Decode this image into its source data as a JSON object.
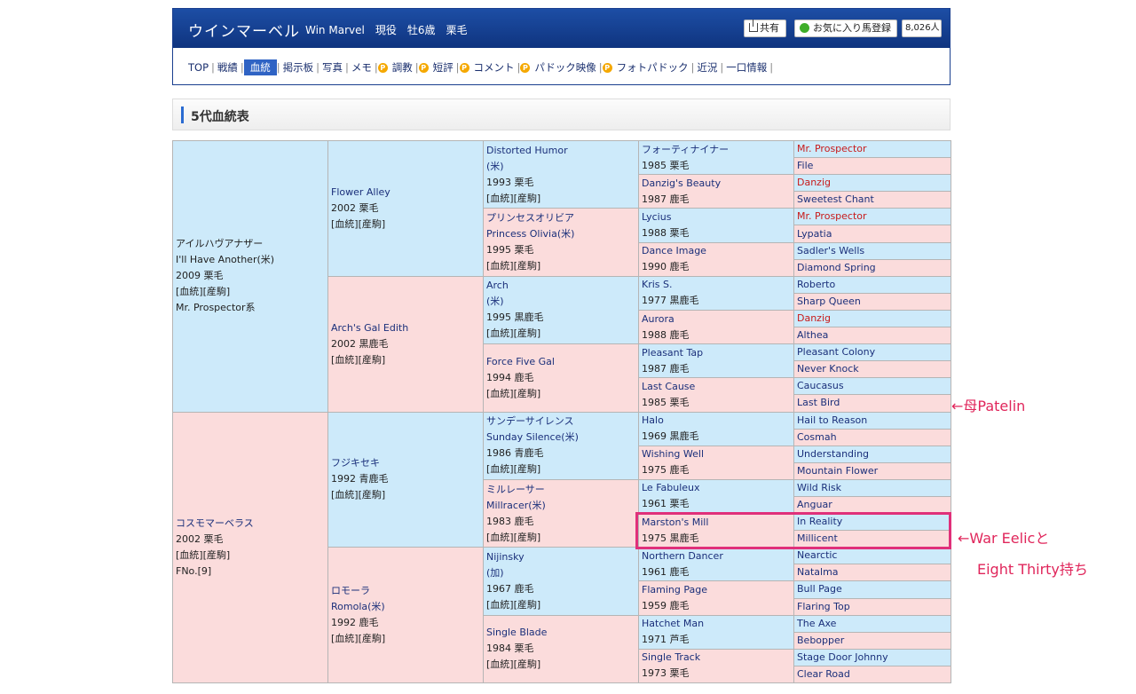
{
  "header": {
    "horse_name": "ウインマーベル",
    "horse_sub": "Win Marvel　現役　牡6歳　栗毛",
    "share_label": "共有",
    "fav_label": "お気に入り馬登録",
    "fav_count": "8,026人"
  },
  "nav": {
    "items": [
      {
        "label": "TOP",
        "p": false,
        "active": false
      },
      {
        "label": "戦績",
        "p": false,
        "active": false
      },
      {
        "label": "血統",
        "p": false,
        "active": true
      },
      {
        "label": "掲示板",
        "p": false,
        "active": false
      },
      {
        "label": "写真",
        "p": false,
        "active": false
      },
      {
        "label": "メモ",
        "p": false,
        "active": false
      },
      {
        "label": "調教",
        "p": true,
        "active": false
      },
      {
        "label": "短評",
        "p": true,
        "active": false
      },
      {
        "label": "コメント",
        "p": true,
        "active": false
      },
      {
        "label": "パドック映像",
        "p": true,
        "active": false
      },
      {
        "label": "フォトパドック",
        "p": true,
        "active": false
      },
      {
        "label": "近況",
        "p": false,
        "active": false
      },
      {
        "label": "一口情報",
        "p": false,
        "active": false
      }
    ]
  },
  "section_title": "5代血統表",
  "pedigree": {
    "g1": [
      {
        "sex": "m",
        "lines": [
          "アイルハヴアナザー",
          "I'll Have Another(米)",
          "2009 栗毛",
          "[血統][産駒]",
          "Mr. Prospector系"
        ]
      },
      {
        "sex": "f",
        "lines": [
          "コスモマーベラス",
          "2002 栗毛",
          "[血統][産駒]",
          "FNo.[9]"
        ]
      }
    ],
    "g2": [
      {
        "sex": "m",
        "lines": [
          "Flower Alley",
          "2002 栗毛",
          "[血統][産駒]"
        ]
      },
      {
        "sex": "f",
        "lines": [
          "Arch's Gal Edith",
          "2002 黒鹿毛",
          "[血統][産駒]"
        ]
      },
      {
        "sex": "m",
        "lines": [
          "フジキセキ",
          "1992 青鹿毛",
          "[血統][産駒]"
        ]
      },
      {
        "sex": "f",
        "lines": [
          "ロモーラ",
          "Romola(米)",
          "1992 鹿毛",
          "[血統][産駒]"
        ]
      }
    ],
    "g3": [
      {
        "sex": "m",
        "lines": [
          "Distorted Humor",
          "(米)",
          "1993 栗毛",
          "[血統][産駒]"
        ]
      },
      {
        "sex": "f",
        "lines": [
          "プリンセスオリビア",
          "Princess Olivia(米)",
          "1995 栗毛",
          "[血統][産駒]"
        ]
      },
      {
        "sex": "m",
        "lines": [
          "Arch",
          "(米)",
          "1995 黒鹿毛",
          "[血統][産駒]"
        ]
      },
      {
        "sex": "f",
        "lines": [
          "Force Five Gal",
          "1994 鹿毛",
          "[血統][産駒]"
        ]
      },
      {
        "sex": "m",
        "lines": [
          "サンデーサイレンス",
          "Sunday Silence(米)",
          "1986 青鹿毛",
          "[血統][産駒]"
        ]
      },
      {
        "sex": "f",
        "lines": [
          "ミルレーサー",
          "Millracer(米)",
          "1983 鹿毛",
          "[血統][産駒]"
        ]
      },
      {
        "sex": "m",
        "lines": [
          "Nijinsky",
          "(加)",
          "1967 鹿毛",
          "[血統][産駒]"
        ]
      },
      {
        "sex": "f",
        "lines": [
          "Single Blade",
          "1984 栗毛",
          "[血統][産駒]"
        ]
      }
    ],
    "g4": [
      {
        "sex": "m",
        "lines": [
          "フォーティナイナー",
          "1985 栗毛"
        ]
      },
      {
        "sex": "f",
        "lines": [
          "Danzig's Beauty",
          "1987 鹿毛"
        ]
      },
      {
        "sex": "m",
        "lines": [
          "Lycius",
          "1988 栗毛"
        ]
      },
      {
        "sex": "f",
        "lines": [
          "Dance Image",
          "1990 鹿毛"
        ]
      },
      {
        "sex": "m",
        "lines": [
          "Kris S.",
          "1977 黒鹿毛"
        ]
      },
      {
        "sex": "f",
        "lines": [
          "Aurora",
          "1988 鹿毛"
        ]
      },
      {
        "sex": "m",
        "lines": [
          "Pleasant Tap",
          "1987 鹿毛"
        ]
      },
      {
        "sex": "f",
        "lines": [
          "Last Cause",
          "1985 栗毛"
        ]
      },
      {
        "sex": "m",
        "lines": [
          "Halo",
          "1969 黒鹿毛"
        ]
      },
      {
        "sex": "f",
        "lines": [
          "Wishing Well",
          "1975 鹿毛"
        ]
      },
      {
        "sex": "m",
        "lines": [
          "Le Fabuleux",
          "1961 栗毛"
        ]
      },
      {
        "sex": "f",
        "lines": [
          "Marston's Mill",
          "1975 黒鹿毛"
        ]
      },
      {
        "sex": "m",
        "lines": [
          "Northern Dancer",
          "1961 鹿毛"
        ]
      },
      {
        "sex": "f",
        "lines": [
          "Flaming Page",
          "1959 鹿毛"
        ]
      },
      {
        "sex": "m",
        "lines": [
          "Hatchet Man",
          "1971 芦毛"
        ]
      },
      {
        "sex": "f",
        "lines": [
          "Single Track",
          "1973 栗毛"
        ]
      }
    ],
    "g5": [
      {
        "sex": "m",
        "name": "Mr. Prospector",
        "red": true
      },
      {
        "sex": "f",
        "name": "File",
        "red": false
      },
      {
        "sex": "m",
        "name": "Danzig",
        "red": true
      },
      {
        "sex": "f",
        "name": "Sweetest Chant",
        "red": false
      },
      {
        "sex": "m",
        "name": "Mr. Prospector",
        "red": true
      },
      {
        "sex": "f",
        "name": "Lypatia",
        "red": false
      },
      {
        "sex": "m",
        "name": "Sadler's Wells",
        "red": false
      },
      {
        "sex": "f",
        "name": "Diamond Spring",
        "red": false
      },
      {
        "sex": "m",
        "name": "Roberto",
        "red": false
      },
      {
        "sex": "f",
        "name": "Sharp Queen",
        "red": false
      },
      {
        "sex": "m",
        "name": "Danzig",
        "red": true
      },
      {
        "sex": "f",
        "name": "Althea",
        "red": false
      },
      {
        "sex": "m",
        "name": "Pleasant Colony",
        "red": false
      },
      {
        "sex": "f",
        "name": "Never Knock",
        "red": false
      },
      {
        "sex": "m",
        "name": "Caucasus",
        "red": false
      },
      {
        "sex": "f",
        "name": "Last Bird",
        "red": false
      },
      {
        "sex": "m",
        "name": "Hail to Reason",
        "red": false
      },
      {
        "sex": "f",
        "name": "Cosmah",
        "red": false
      },
      {
        "sex": "m",
        "name": "Understanding",
        "red": false
      },
      {
        "sex": "f",
        "name": "Mountain Flower",
        "red": false
      },
      {
        "sex": "m",
        "name": "Wild Risk",
        "red": false
      },
      {
        "sex": "f",
        "name": "Anguar",
        "red": false
      },
      {
        "sex": "m",
        "name": "In Reality",
        "red": false
      },
      {
        "sex": "f",
        "name": "Millicent",
        "red": false
      },
      {
        "sex": "m",
        "name": "Nearctic",
        "red": false
      },
      {
        "sex": "f",
        "name": "Natalma",
        "red": false
      },
      {
        "sex": "m",
        "name": "Bull Page",
        "red": false
      },
      {
        "sex": "f",
        "name": "Flaring Top",
        "red": false
      },
      {
        "sex": "m",
        "name": "The Axe",
        "red": false
      },
      {
        "sex": "f",
        "name": "Bebopper",
        "red": false
      },
      {
        "sex": "m",
        "name": "Stage Door Johnny",
        "red": false
      },
      {
        "sex": "f",
        "name": "Clear Road",
        "red": false
      }
    ]
  },
  "annotations": {
    "patelin": "←母Patelin",
    "war_relic_1": "←War Eelicと",
    "war_relic_2": "Eight Thirty持ち"
  }
}
